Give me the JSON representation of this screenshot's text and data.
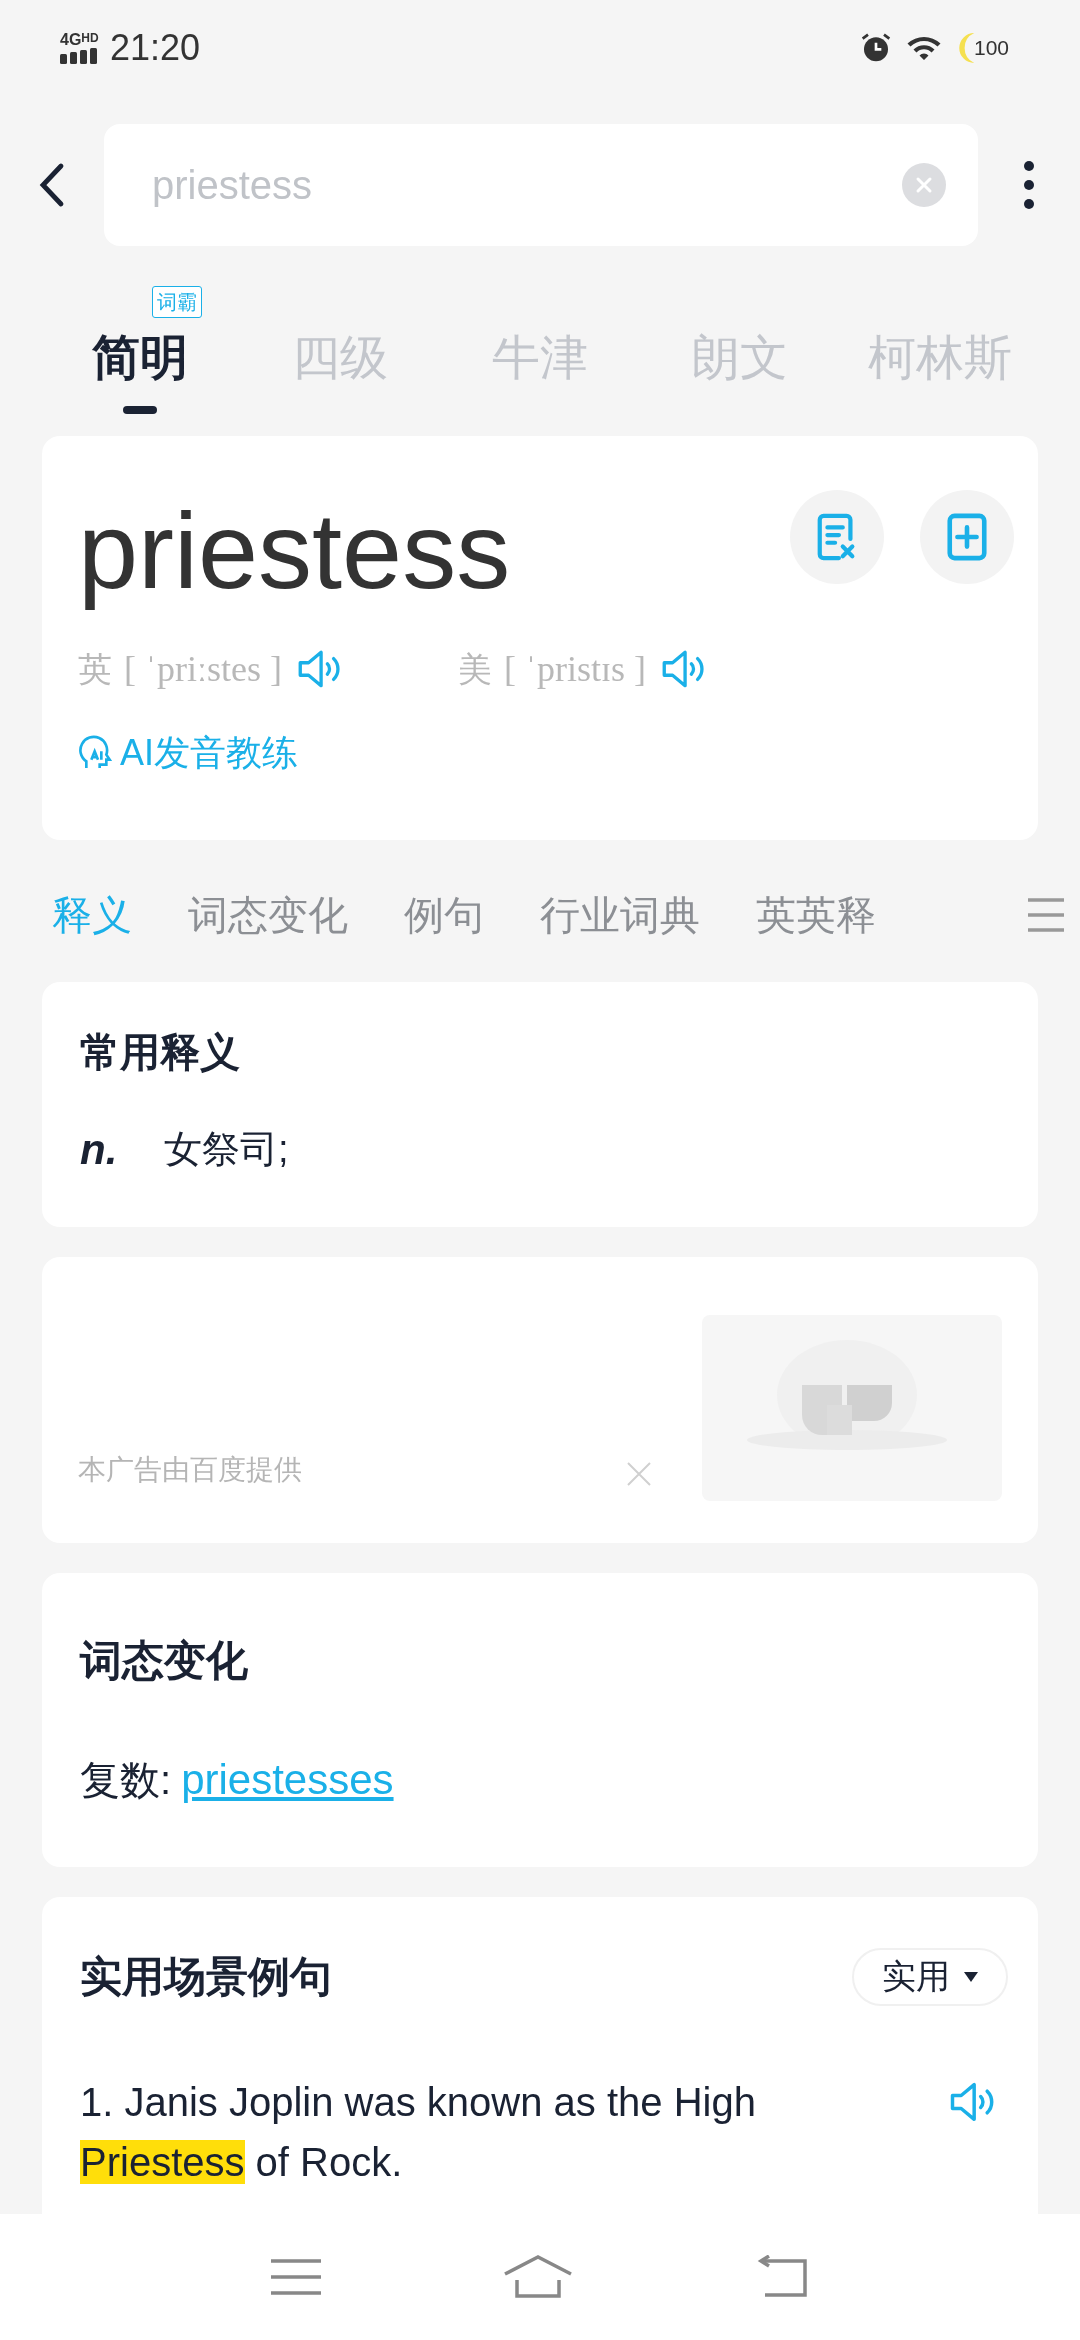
{
  "status_bar": {
    "network": "4G",
    "network_sub": "HD",
    "time": "21:20",
    "battery": "100"
  },
  "search": {
    "value": "priestess"
  },
  "dict_tabs": [
    {
      "label": "简明",
      "selected": true,
      "badge": "词霸"
    },
    {
      "label": "四级",
      "selected": false
    },
    {
      "label": "牛津",
      "selected": false
    },
    {
      "label": "朗文",
      "selected": false
    },
    {
      "label": "柯林斯",
      "selected": false
    }
  ],
  "word": {
    "headword": "priestess",
    "pronunciations": [
      {
        "region": "英",
        "ipa": "[ ˈpriːstes ]"
      },
      {
        "region": "美",
        "ipa": "[ ˈpristɪs ]"
      }
    ],
    "ai_coach": "AI发音教练"
  },
  "section_tabs": [
    {
      "label": "释义",
      "selected": true
    },
    {
      "label": "词态变化",
      "selected": false
    },
    {
      "label": "例句",
      "selected": false
    },
    {
      "label": "行业词典",
      "selected": false
    },
    {
      "label": "英英释",
      "selected": false
    }
  ],
  "definitions": {
    "title": "常用释义",
    "items": [
      {
        "pos": "n.",
        "meaning": "女祭司;"
      }
    ]
  },
  "ad": {
    "caption": "本广告由百度提供"
  },
  "inflections": {
    "title": "词态变化",
    "items": [
      {
        "label": "复数:",
        "value": "priestesses"
      }
    ]
  },
  "examples": {
    "title": "实用场景例句",
    "filter": "实用",
    "items": [
      {
        "segments": [
          {
            "text": "1. Janis Joplin was known as the High ",
            "highlighted": false
          },
          {
            "text": "Priestess",
            "highlighted": true
          },
          {
            "text": " of Rock.",
            "highlighted": false
          }
        ]
      }
    ]
  }
}
